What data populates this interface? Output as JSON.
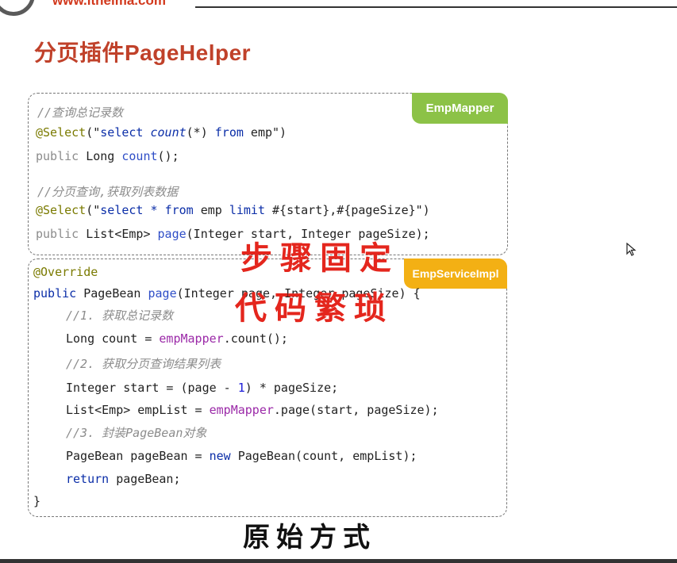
{
  "header": {
    "url": "www.itheima.com"
  },
  "page_title": "分页插件PageHelper",
  "mapper_box": {
    "tag": "EmpMapper",
    "lines": [
      "//查询总记录数",
      "@Select",
      "(\"",
      "select ",
      "count",
      "(*) ",
      "from",
      " emp\")",
      "public",
      " Long ",
      "count",
      "();",
      "//分页查询,获取列表数据",
      "@Select",
      "(\"",
      "select * ",
      "from",
      " emp ",
      "limit",
      " #{start},#{pageSize}\")",
      "public",
      " List<Emp> ",
      "page",
      "(Integer start, Integer pageSize);"
    ]
  },
  "service_box": {
    "tag": "EmpServiceImpl",
    "lines": [
      "@Override",
      "public",
      " PageBean ",
      "page",
      "(Integer page, Integer pageSize) {",
      "//1. 获取总记录数",
      "Long count = ",
      "empMapper",
      ".count();",
      "//2. 获取分页查询结果列表",
      "Integer start = (page - ",
      "1",
      ") * pageSize;",
      "List<Emp> empList = ",
      "empMapper",
      ".page(start, pageSize);",
      "//3. 封装PageBean对象",
      "PageBean pageBean = ",
      "new",
      " PageBean(count, empList);",
      "return",
      " pageBean;",
      "}"
    ]
  },
  "annotations": {
    "line1": "步骤固定",
    "line2": "代码繁琐",
    "bottom": "原始方式"
  },
  "colors": {
    "title": "#c0412a",
    "tag_mapper": "#8cc247",
    "tag_service": "#f3b014",
    "handwriting": "#e4261d"
  }
}
